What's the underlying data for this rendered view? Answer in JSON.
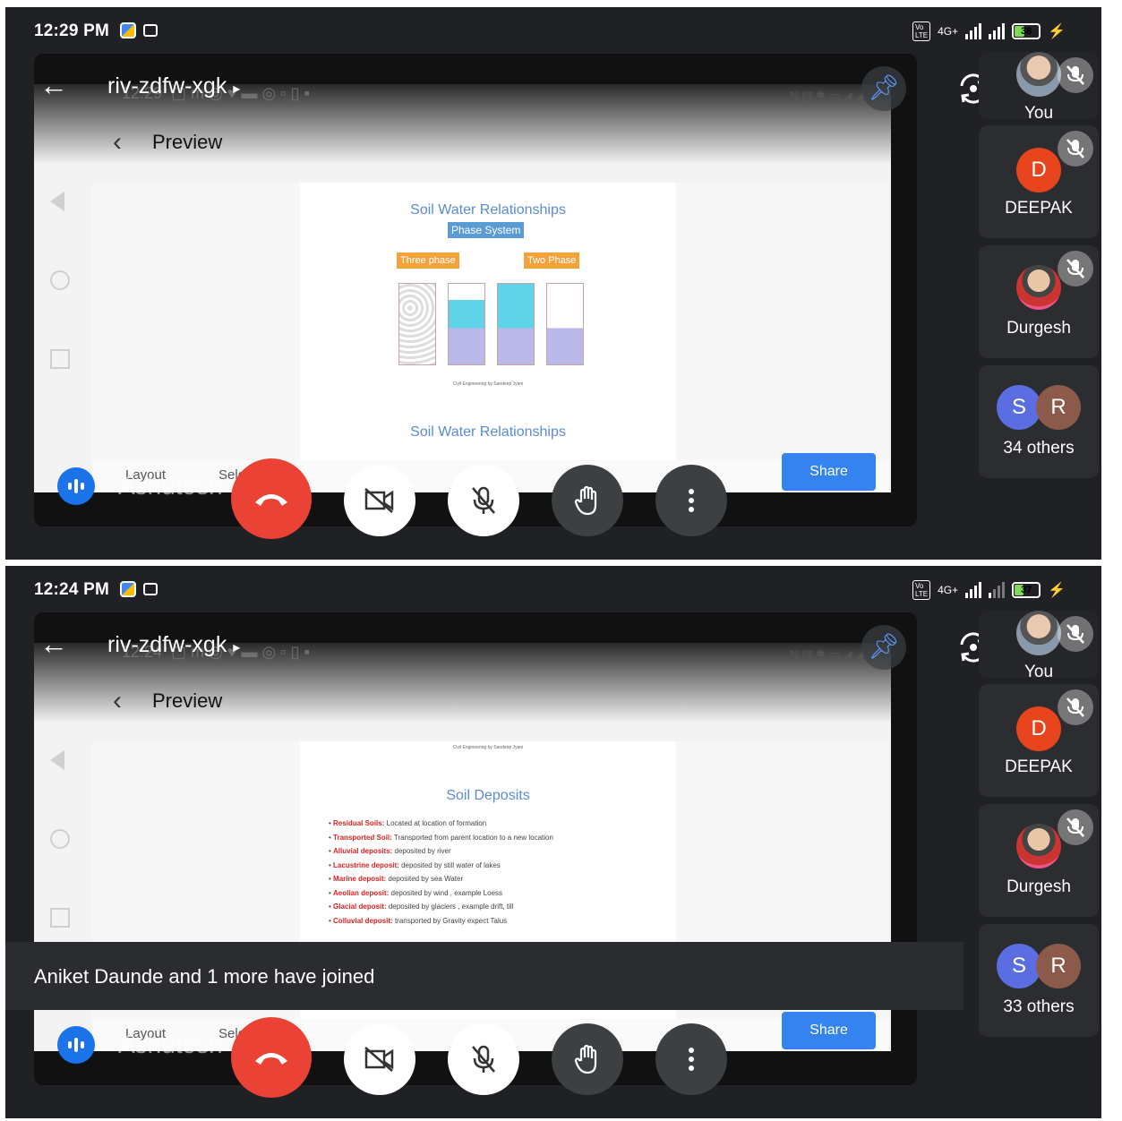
{
  "panels": [
    {
      "status": {
        "time": "12:29 PM",
        "network": "4G+",
        "battery": "38"
      },
      "meeting_code": "riv-zdfw-xgk",
      "screen": {
        "ghost_time": "12:29",
        "preview_title": "Preview",
        "slide_title_top": "Soil Water Relationships",
        "phase_system": "Phase System",
        "three_phase": "Three phase",
        "two_phase": "Two Phase",
        "slide_title_bottom": "Soil Water Relationships",
        "layout_label": "Layout",
        "select_label": "Select area",
        "share_label": "Share"
      },
      "presenter": "Ashutosh",
      "participants": {
        "you": "You",
        "p2_initial": "D",
        "p2_name": "DEEPAK",
        "p2_color": "#e8451e",
        "p3_name": "Durgesh",
        "others_initial_1": "S",
        "others_initial_2": "R",
        "others_label": "34 others"
      }
    },
    {
      "status": {
        "time": "12:24 PM",
        "network": "4G+",
        "battery": "37"
      },
      "meeting_code": "riv-zdfw-xgk",
      "screen": {
        "ghost_time": "12:24",
        "preview_title": "Preview",
        "slide_title": "Soil Deposits",
        "bullets": [
          {
            "term": "Residual Soils:",
            "text": "Located at location of formation"
          },
          {
            "term": "Transported Soil:",
            "text": "Transported from parent location to a new location"
          },
          {
            "term": "Alluvial deposits:",
            "text": "deposited by river"
          },
          {
            "term": "Lacustrine deposit:",
            "text": "deposited by still water of lakes"
          },
          {
            "term": "Marine deposit:",
            "text": "deposited by sea Water"
          },
          {
            "term": "Aeolian deposit:",
            "text": "deposited by wind , example Loess"
          },
          {
            "term": "Glacial deposit:",
            "text": "deposited by glaciers , example drift, till"
          },
          {
            "term": "Colluvial deposit:",
            "text": "transported by Gravity expect Talus"
          }
        ],
        "layout_label": "Layout",
        "select_label": "Select area",
        "share_label": "Share"
      },
      "toast": "Aniket Daunde and 1 more have joined",
      "presenter": "Ashutosh",
      "participants": {
        "you": "You",
        "p2_initial": "D",
        "p2_name": "DEEPAK",
        "p2_color": "#e8451e",
        "p3_name": "Durgesh",
        "others_initial_1": "S",
        "others_initial_2": "R",
        "others_label": "33 others"
      }
    }
  ],
  "colors": {
    "accent": "#1a73e8",
    "end_call": "#ea4335",
    "share": "#3483f0",
    "others_s": "#5b6ee1",
    "others_r": "#8c5a4a"
  }
}
